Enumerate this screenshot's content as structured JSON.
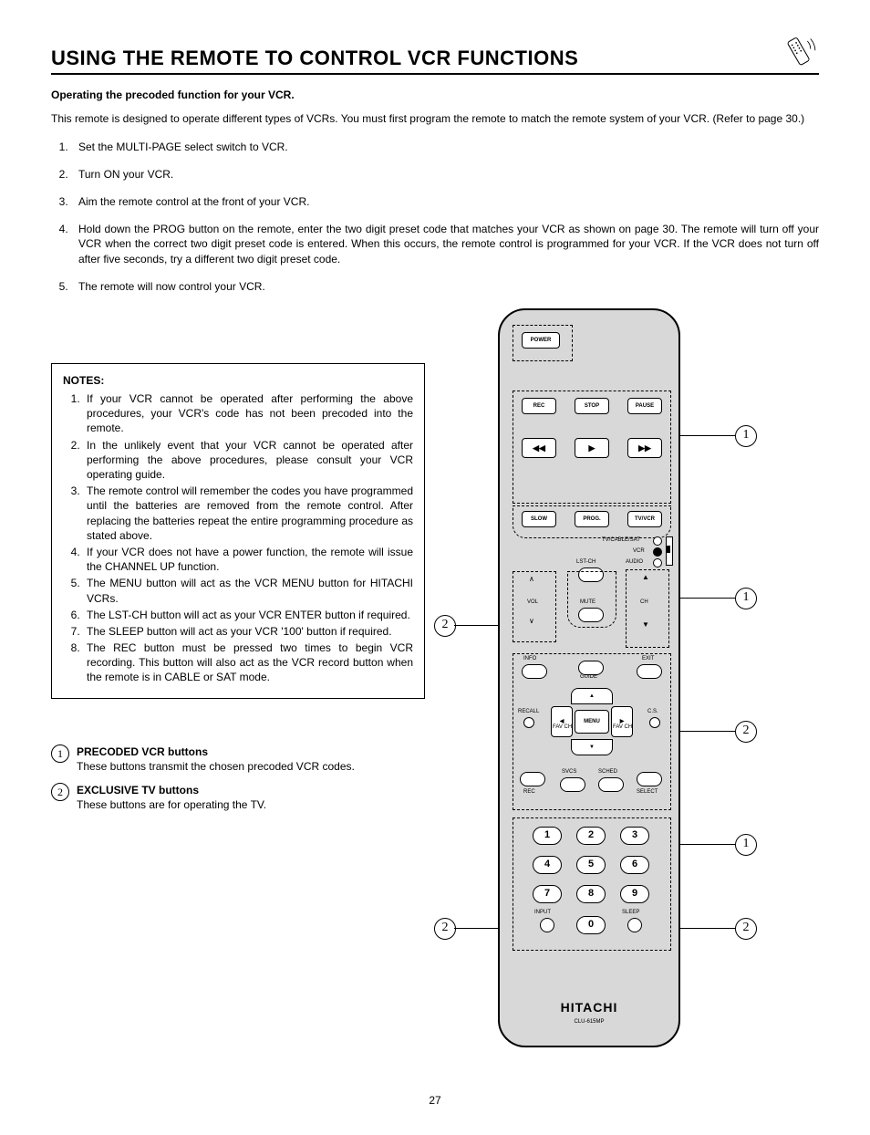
{
  "header": {
    "title": "USING THE REMOTE TO CONTROL VCR FUNCTIONS"
  },
  "subhead": "Operating the precoded function for your VCR.",
  "intro": "This remote is designed to operate different types of VCRs.  You must first program the remote to match the remote system of your VCR. (Refer to page 30.)",
  "steps": [
    "Set the MULTI-PAGE select switch to VCR.",
    "Turn ON your VCR.",
    "Aim the remote control at the front of your VCR.",
    "Hold down the PROG button on the remote, enter the two digit preset code that matches your VCR as shown on page 30.  The remote will turn off your VCR when the correct two digit preset code is entered.  When this occurs, the remote control is programmed for your VCR.  If the VCR does not turn off after five seconds, try a different two digit preset code.",
    "The remote will now control your VCR."
  ],
  "notes": {
    "title": "NOTES:",
    "items": [
      "If your VCR cannot be operated after performing the above procedures, your VCR's code has not been precoded into the remote.",
      "In the unlikely event that your VCR cannot be operated after performing the above procedures, please consult your VCR operating guide.",
      "The remote control will remember the codes you have programmed until the batteries are removed from the remote control.  After replacing the batteries repeat the entire programming procedure as stated above.",
      "If your VCR does not have a power function, the remote will issue the CHANNEL UP function.",
      "The MENU button will act as the VCR MENU button for HITACHI VCRs.",
      "The LST-CH button will act as your VCR ENTER button if required.",
      "The SLEEP button will act as your VCR '100' button if required.",
      "The REC button must be pressed two times to begin VCR recording.  This button will also act as the VCR record button when the remote is in CABLE or SAT mode."
    ]
  },
  "legend": [
    {
      "num": "1",
      "title": "PRECODED VCR buttons",
      "desc": "These buttons transmit the chosen precoded VCR codes."
    },
    {
      "num": "2",
      "title": "EXCLUSIVE TV buttons",
      "desc": "These buttons are for operating the TV."
    }
  ],
  "remote": {
    "brand": "HITACHI",
    "model": "CLU-615MP",
    "buttons": {
      "power": "POWER",
      "rec": "REC",
      "stop": "STOP",
      "pause": "PAUSE",
      "rew": "◀◀",
      "play": "▶",
      "ff": "▶▶",
      "slow": "SLOW",
      "prog": "PROG.",
      "tvvcr": "TV/VCR",
      "tvcablesat": "TV/CABLE/SAT",
      "vcr": "VCR",
      "audio": "AUDIO",
      "lstch": "LST-CH",
      "vol": "VOL",
      "mute": "MUTE",
      "ch": "CH",
      "info": "INFO",
      "guide": "GUIDE",
      "exit": "EXIT",
      "recall": "RECALL",
      "menu": "MENU",
      "cs": "C.S.",
      "favch_l": "FAV CH",
      "favch_r": "FAV CH",
      "svcs": "SVCS",
      "sched": "SCHED",
      "select": "SELECT",
      "rec2": "REC",
      "n1": "1",
      "n2": "2",
      "n3": "3",
      "n4": "4",
      "n5": "5",
      "n6": "6",
      "n7": "7",
      "n8": "8",
      "n9": "9",
      "n0": "0",
      "input": "INPUT",
      "sleep": "SLEEP"
    }
  },
  "callouts": {
    "right": [
      "1",
      "1",
      "2",
      "1",
      "2"
    ],
    "left": [
      "2",
      "2"
    ]
  },
  "page_number": "27"
}
